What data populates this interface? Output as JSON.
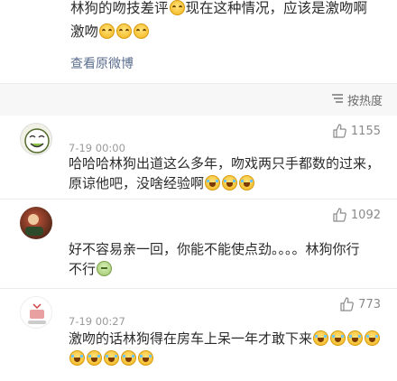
{
  "post": {
    "line1_a": "林狗的吻技差评",
    "line1_b": "现在这种情况，应该是激吻啊",
    "line2": "激吻",
    "view_original": "查看原微博"
  },
  "sort": {
    "label": "按热度",
    "icon": "sort-lines-icon"
  },
  "comments": [
    {
      "time": "7-19 00:00",
      "likes": "1155",
      "text_a": "哈哈哈林狗出道这么多年，吻戏两只手都数的过来，",
      "text_b": "原谅他吧，没啥经验啊",
      "avatar": "cartoon-face-avatar"
    },
    {
      "time": "",
      "likes": "1092",
      "text_a": "好不容易亲一回，你能不能使点劲。。。。林狗你行",
      "text_b": "不行",
      "avatar": "photo-avatar"
    },
    {
      "time": "7-19 00:27",
      "likes": "773",
      "text_a": "激吻的话林狗得在房车上呆一年才敢下来",
      "avatar": "small-figure-avatar"
    }
  ],
  "colors": {
    "link": "#5c6f8f",
    "meta": "#9a9a9a",
    "sort_bg": "#f7f7f7"
  }
}
